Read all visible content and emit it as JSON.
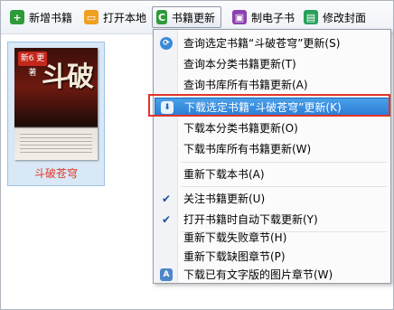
{
  "toolbar": {
    "items": [
      {
        "label": "新增书籍",
        "icon": "add-book-icon",
        "color": "#2e9a3a"
      },
      {
        "label": "打开本地",
        "icon": "open-folder-icon",
        "color": "#f0a020"
      },
      {
        "label": "书籍更新",
        "icon": "update-icon",
        "color": "#2e9a3a"
      },
      {
        "label": "制电子书",
        "icon": "ebook-icon",
        "color": "#8b3fb0"
      },
      {
        "label": "修改封面",
        "icon": "cover-edit-icon",
        "color": "#27a05a"
      }
    ]
  },
  "book": {
    "badge": "新6 更 著",
    "cover_title": "斗破",
    "caption": "斗破苍穹"
  },
  "menu": {
    "items": [
      {
        "label": "查询选定书籍“斗破苍穹”更新(S)",
        "icon": "refresh-icon"
      },
      {
        "label": "查询本分类书籍更新(T)"
      },
      {
        "label": "查询书库所有书籍更新(A)"
      },
      {
        "label": "下载选定书籍“斗破苍穹”更新(K)",
        "icon": "download-icon",
        "selected": true
      },
      {
        "label": "下载本分类书籍更新(O)"
      },
      {
        "label": "下载书库所有书籍更新(W)"
      },
      {
        "label": "重新下载本书(A)"
      },
      {
        "label": "关注书籍更新(U)",
        "checked": true
      },
      {
        "label": "打开书籍时自动下载更新(Y)",
        "checked": true
      },
      {
        "label": "重新下载失败章节(H)"
      },
      {
        "label": "重新下载缺图章节(P)"
      },
      {
        "label": "下载已有文字版的图片章节(W)",
        "icon": "image-text-icon"
      }
    ]
  },
  "colors": {
    "highlight_border": "#e2332a",
    "selection": "#2b7dd6",
    "caption": "#e23a2a"
  }
}
